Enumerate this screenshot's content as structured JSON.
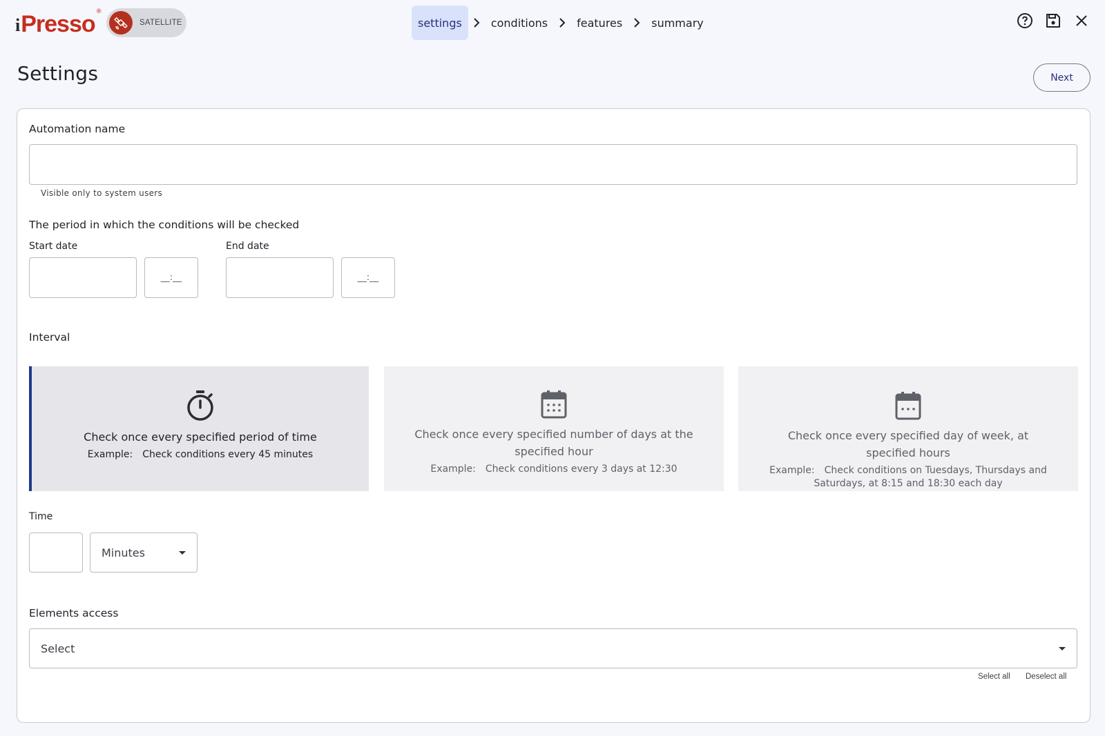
{
  "header": {
    "logo_i": "i",
    "logo_text": "Presso",
    "logo_reg": "®",
    "badge_label": "SATELLITE",
    "steps": [
      {
        "label": "settings",
        "active": true
      },
      {
        "label": "conditions",
        "active": false
      },
      {
        "label": "features",
        "active": false
      },
      {
        "label": "summary",
        "active": false
      }
    ],
    "actions": [
      "help-icon",
      "save-icon",
      "close-icon"
    ]
  },
  "page": {
    "title": "Settings",
    "next_label": "Next"
  },
  "form": {
    "automation_name_label": "Automation name",
    "automation_name_value": "",
    "automation_name_hint": "Visible only to system users",
    "period_label": "The period in which the conditions will be checked",
    "start_date_label": "Start date",
    "end_date_label": "End date",
    "start_date_value": "",
    "end_date_value": "",
    "time_placeholder": "__:__",
    "interval_label": "Interval",
    "interval_options": [
      {
        "title": "Check once every specified period of time",
        "example_label": "Example:",
        "example_text": "Check conditions every 45 minutes",
        "icon": "stopwatch-icon",
        "selected": true
      },
      {
        "title": "Check once every specified number of days at the specified hour",
        "example_label": "Example:",
        "example_text": "Check conditions every 3 days at 12:30",
        "icon": "calendar-icon",
        "selected": false
      },
      {
        "title": "Check once every specified day of week, at specified hours",
        "example_label": "Example:",
        "example_text": "Check conditions on Tuesdays, Thursdays and Saturdays, at 8:15 and 18:30 each day",
        "icon": "calendar-icon",
        "selected": false
      }
    ],
    "time_label": "Time",
    "time_value": "",
    "time_unit": "Minutes",
    "elements_access_label": "Elements access",
    "elements_access_value": "Select",
    "select_all_label": "Select all",
    "deselect_all_label": "Deselect all"
  },
  "colors": {
    "accent": "#27317a",
    "selected_border": "#1f3a8a",
    "brand_red": "#c62d1f",
    "active_step_bg": "#d9e1fb"
  }
}
